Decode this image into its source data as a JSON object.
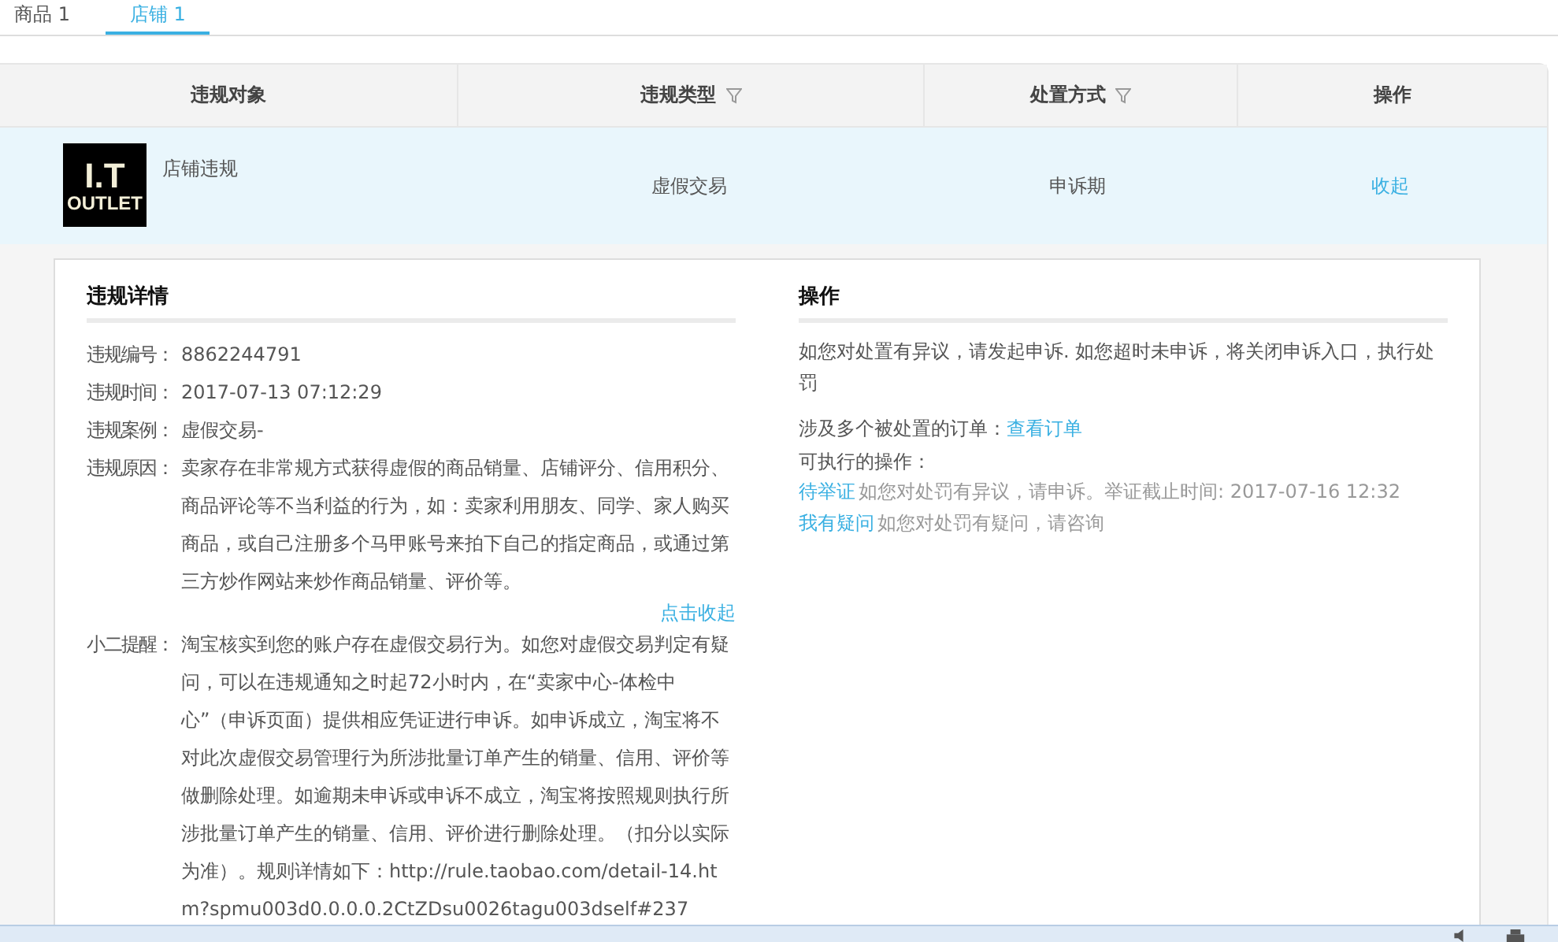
{
  "tabs": [
    {
      "label": "商品 1",
      "selected": false
    },
    {
      "label": "店铺 1",
      "selected": true
    }
  ],
  "table": {
    "columns": [
      {
        "label": "违规对象",
        "filter": false
      },
      {
        "label": "违规类型",
        "filter": true
      },
      {
        "label": "处置方式",
        "filter": true
      },
      {
        "label": "操作",
        "filter": false
      }
    ],
    "rows": [
      {
        "logo_lines": [
          "I.T",
          "OUTLET"
        ],
        "object": "店铺违规",
        "type": "虚假交易",
        "handling": "申诉期",
        "action": "收起",
        "expanded": true
      }
    ]
  },
  "details": {
    "title": "违规详情",
    "fields": [
      {
        "label": "违规编号：",
        "value": "8862244791"
      },
      {
        "label": "违规时间：",
        "value": "2017-07-13 07:12:29"
      },
      {
        "label": "违规案例：",
        "value": "虚假交易-"
      },
      {
        "label": "违规原因：",
        "value": "卖家存在非常规方式获得虚假的商品销量、店铺评分、信用积分、商品评论等不当利益的行为，如：卖家利用朋友、同学、家人购买商品，或自己注册多个马甲账号来拍下自己的指定商品，或通过第三方炒作网站来炒作商品销量、评价等。"
      }
    ],
    "collapse_link": "点击收起",
    "reminder": {
      "label": "小二提醒：",
      "value": "淘宝核实到您的账户存在虚假交易行为。如您对虚假交易判定有疑问，可以在违规通知之时起72小时内，在“卖家中心-体检中心”（申诉页面）提供相应凭证进行申诉。如申诉成立，淘宝将不对此次虚假交易管理行为所涉批量订单产生的销量、信用、评价等做删除处理。如逾期未申诉或申诉不成立，淘宝将按照规则执行所涉批量订单产生的销量、信用、评价进行删除处理。（扣分以实际为准）。规则详情如下：http://rule.taobao.com/detail-14.htm?spmu003d0.0.0.0.2CtZDsu0026tagu003dself#237"
    }
  },
  "operations": {
    "title": "操作",
    "notice": "如您对处置有异议，请发起申诉. 如您超时未申诉，将关闭申诉入口，执行处罚",
    "orders_label": "涉及多个被处置的订单：",
    "orders_link": "查看订单",
    "available_label": "可执行的操作：",
    "actions": [
      {
        "link": "待举证",
        "text": "如您对处罚有异议，请申诉。举证截止时间: 2017-07-16 12:32"
      },
      {
        "link": "我有疑问",
        "text": "如您对处罚有疑问，请咨询"
      }
    ]
  }
}
